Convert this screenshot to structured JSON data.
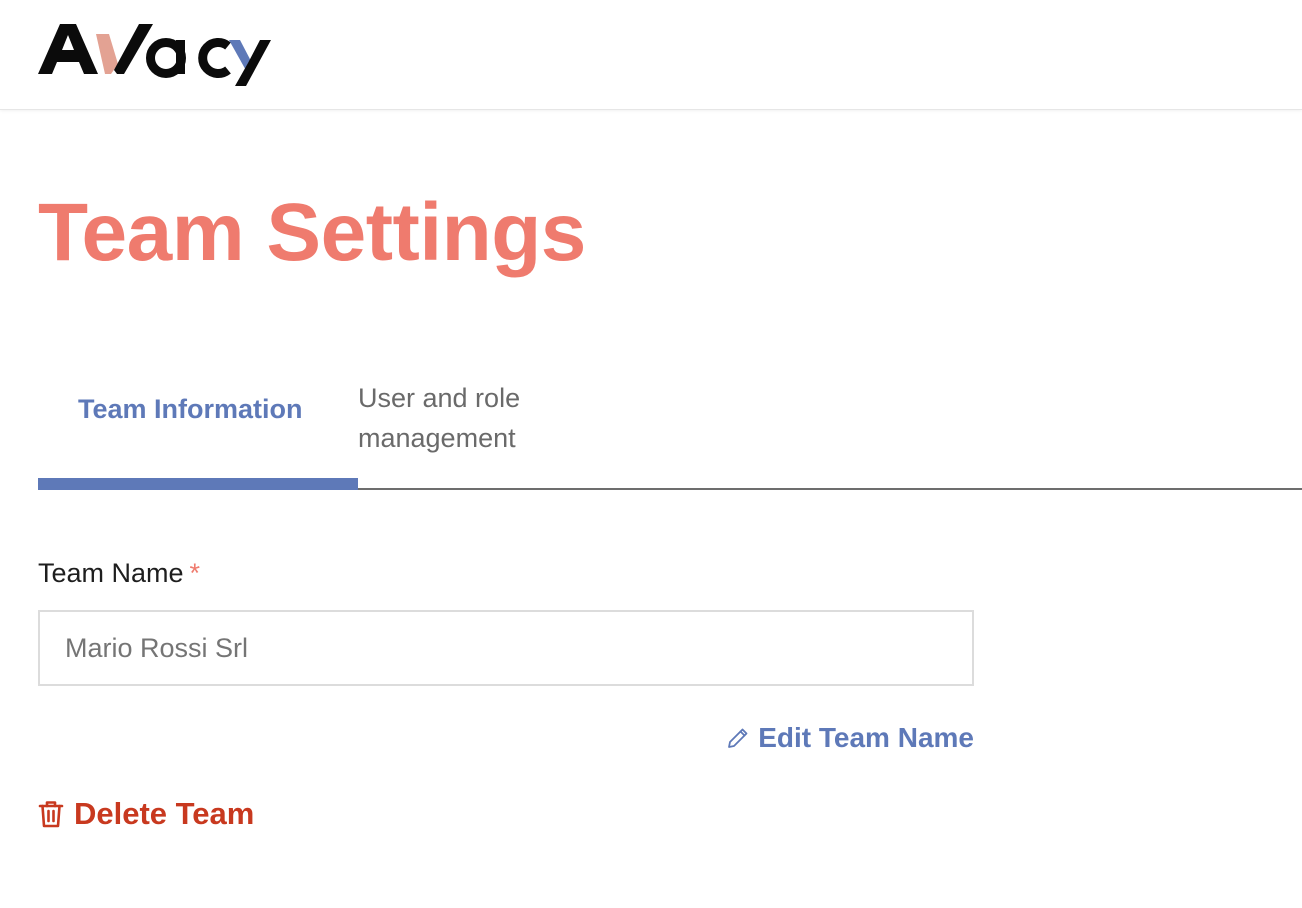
{
  "brand": {
    "logo_text": "Avacy",
    "colors": {
      "dark": "#0b0b0b",
      "accent_v": "#e3a293",
      "accent_y": "#5e79b8"
    }
  },
  "page": {
    "title": "Team Settings",
    "title_color": "#ef7b6e"
  },
  "tabs": [
    {
      "label": "Team Information",
      "active": true
    },
    {
      "label": "User and role management",
      "active": false
    }
  ],
  "form": {
    "team_name_label": "Team Name",
    "required_mark": "*",
    "team_name_placeholder": "Mario Rossi Srl",
    "team_name_value": ""
  },
  "actions": {
    "edit_team_name": {
      "label": "Edit Team Name",
      "icon": "pencil-icon",
      "color": "#5e79b8"
    },
    "delete_team": {
      "label": "Delete Team",
      "icon": "trash-icon",
      "color": "#c8391f"
    }
  }
}
